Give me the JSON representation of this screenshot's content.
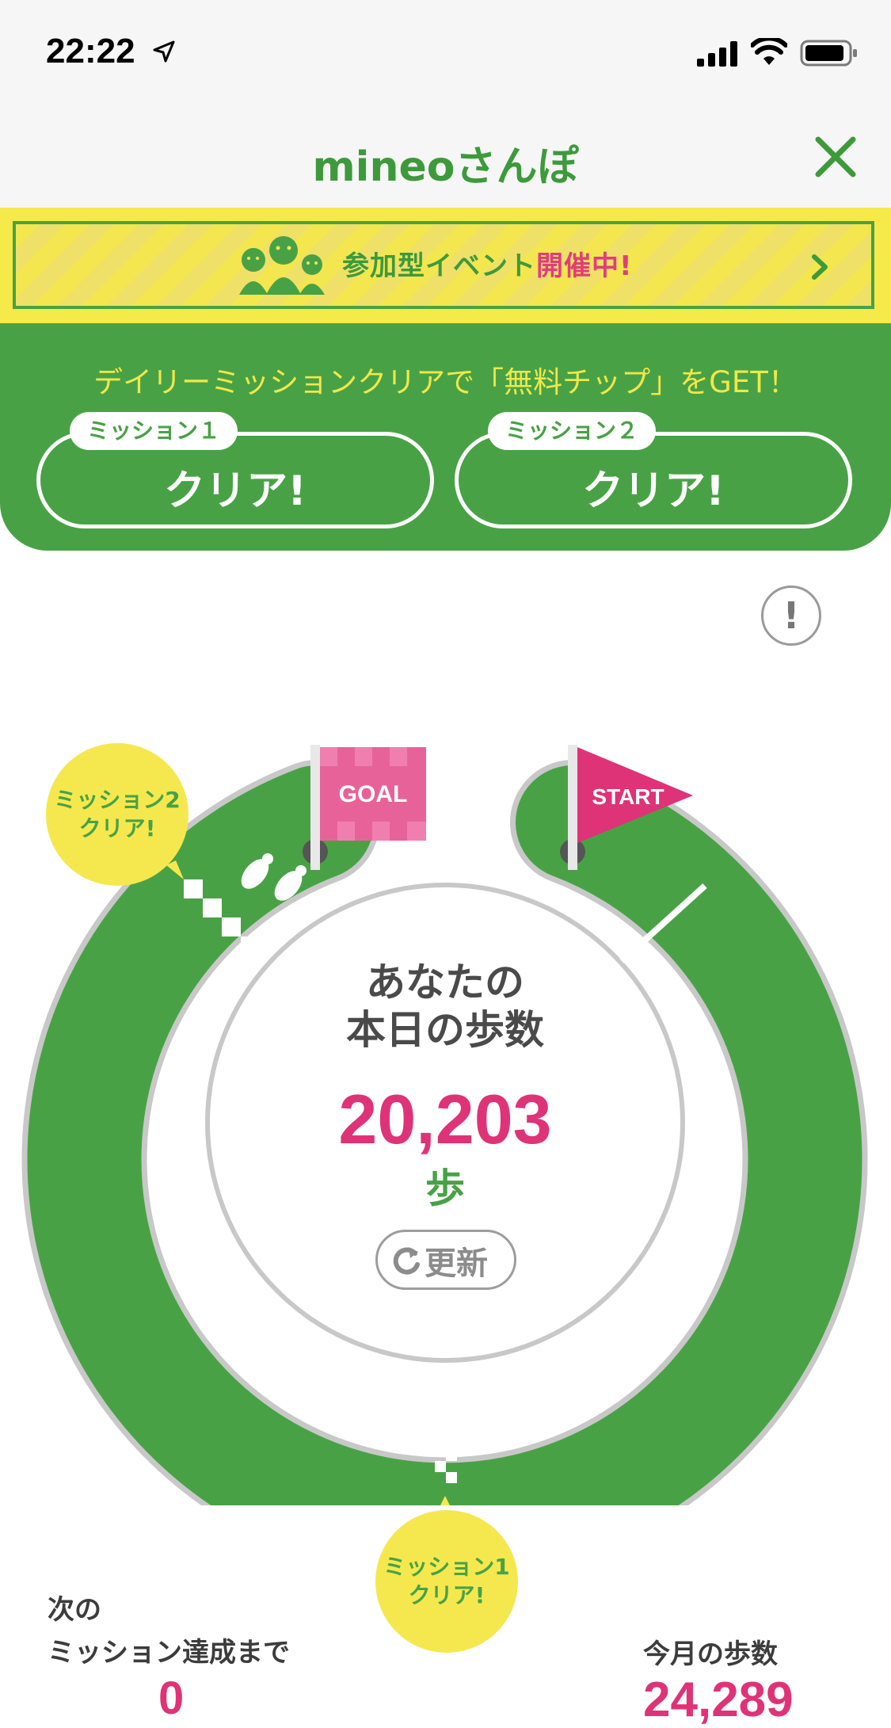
{
  "status_bar": {
    "time": "22:22",
    "icons": [
      "location-arrow-icon",
      "signal-icon",
      "wifi-icon",
      "battery-icon"
    ]
  },
  "nav": {
    "title": "mineoさんぽ",
    "close_icon": "close-icon"
  },
  "event_banner": {
    "text_main": "参加型イベント",
    "text_highlight": "開催中!",
    "icon": "people-icon",
    "chevron": "chevron-right-icon"
  },
  "missions": {
    "lead": "デイリーミッションクリアで「無料チップ」をGET！",
    "items": [
      {
        "tag": "ミッション１",
        "status": "クリア!"
      },
      {
        "tag": "ミッション２",
        "status": "クリア!"
      }
    ]
  },
  "info_button": "!",
  "course": {
    "goal_flag": "GOAL",
    "start_flag": "START",
    "bubble_m2": [
      "ミッション2",
      "クリア!"
    ],
    "bubble_m1": [
      "ミッション1",
      "クリア!"
    ],
    "center_label_line1": "あなたの",
    "center_label_line2": "本日の歩数",
    "steps_today": "20,203",
    "steps_unit": "歩",
    "refresh_label": "更新"
  },
  "stats": {
    "next_label_line1": "次の",
    "next_label_line2": "ミッション達成まで",
    "next_value": "0",
    "month_label": "今月の歩数",
    "month_value": "24,289"
  },
  "colors": {
    "green": "#48a245",
    "yellow": "#f5e84f",
    "pink": "#de3377",
    "track_border": "#c8c8c8"
  }
}
